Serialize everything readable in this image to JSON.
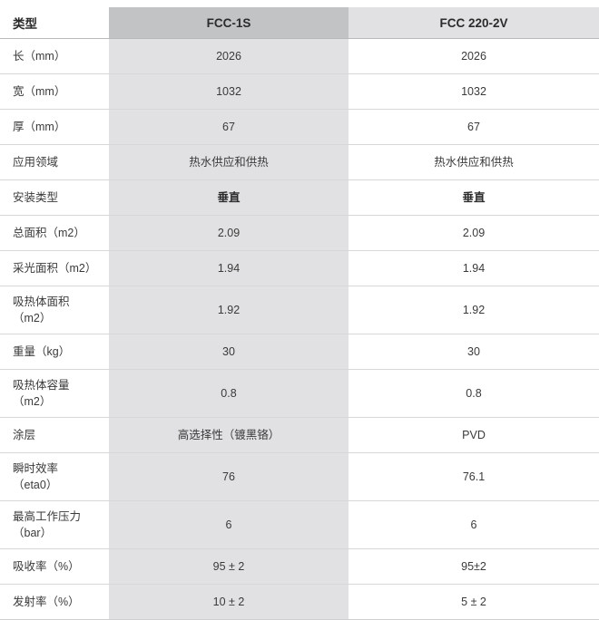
{
  "table": {
    "columns": [
      {
        "key": "label",
        "header": "类型",
        "align": "left"
      },
      {
        "key": "fcc1s",
        "header": "FCC-1S",
        "align": "center"
      },
      {
        "key": "fcc220",
        "header": "FCC 220-2V",
        "align": "center"
      }
    ],
    "rows": [
      {
        "label": "长（mm）",
        "label_line2": "",
        "fcc1s": "2026",
        "fcc220": "2026",
        "bold_a": false,
        "bold_b": false
      },
      {
        "label": "宽（mm）",
        "label_line2": "",
        "fcc1s": "1032",
        "fcc220": "1032",
        "bold_a": false,
        "bold_b": false
      },
      {
        "label": "厚（mm）",
        "label_line2": "",
        "fcc1s": "67",
        "fcc220": "67",
        "bold_a": false,
        "bold_b": false
      },
      {
        "label": "应用领域",
        "label_line2": "",
        "fcc1s": "热水供应和供热",
        "fcc220": "热水供应和供热",
        "bold_a": false,
        "bold_b": false
      },
      {
        "label": "安装类型",
        "label_line2": "",
        "fcc1s": "垂直",
        "fcc220": "垂直",
        "bold_a": true,
        "bold_b": true
      },
      {
        "label": "总面积（m2）",
        "label_line2": "",
        "fcc1s": "2.09",
        "fcc220": "2.09",
        "bold_a": false,
        "bold_b": false
      },
      {
        "label": "采光面积（m2）",
        "label_line2": "",
        "fcc1s": "1.94",
        "fcc220": "1.94",
        "bold_a": false,
        "bold_b": false
      },
      {
        "label": "吸热体面积",
        "label_line2": "（m2）",
        "fcc1s": "1.92",
        "fcc220": "1.92",
        "bold_a": false,
        "bold_b": false
      },
      {
        "label": "重量（kg）",
        "label_line2": "",
        "fcc1s": "30",
        "fcc220": "30",
        "bold_a": false,
        "bold_b": false
      },
      {
        "label": "吸热体容量",
        "label_line2": "（m2）",
        "fcc1s": "0.8",
        "fcc220": "0.8",
        "bold_a": false,
        "bold_b": false
      },
      {
        "label": "涂层",
        "label_line2": "",
        "fcc1s": "高选择性（镀黑铬）",
        "fcc220": "PVD",
        "bold_a": false,
        "bold_b": false
      },
      {
        "label": "瞬时效率",
        "label_line2": "（eta0）",
        "fcc1s": "76",
        "fcc220": "76.1",
        "bold_a": false,
        "bold_b": false
      },
      {
        "label": "最高工作压力",
        "label_line2": "（bar）",
        "fcc1s": "6",
        "fcc220": "6",
        "bold_a": false,
        "bold_b": false
      },
      {
        "label": "吸收率（%）",
        "label_line2": "",
        "fcc1s": "95 ± 2",
        "fcc220": "95±2",
        "bold_a": false,
        "bold_b": false
      },
      {
        "label": "发射率（%）",
        "label_line2": "",
        "fcc1s": "10 ± 2",
        "fcc220": "5 ± 2",
        "bold_a": false,
        "bold_b": false
      }
    ]
  },
  "colors": {
    "page_background": "#ffffff",
    "header_column_a": "#c2c3c5",
    "header_column_b": "#e1e1e3",
    "cell_column_a": "#e1e1e3",
    "cell_column_b": "#ffffff",
    "row_divider": "#d7d7d7",
    "header_divider": "#b9b9b9",
    "text": "#3a3a3a",
    "header_text": "#2b2b2b"
  }
}
